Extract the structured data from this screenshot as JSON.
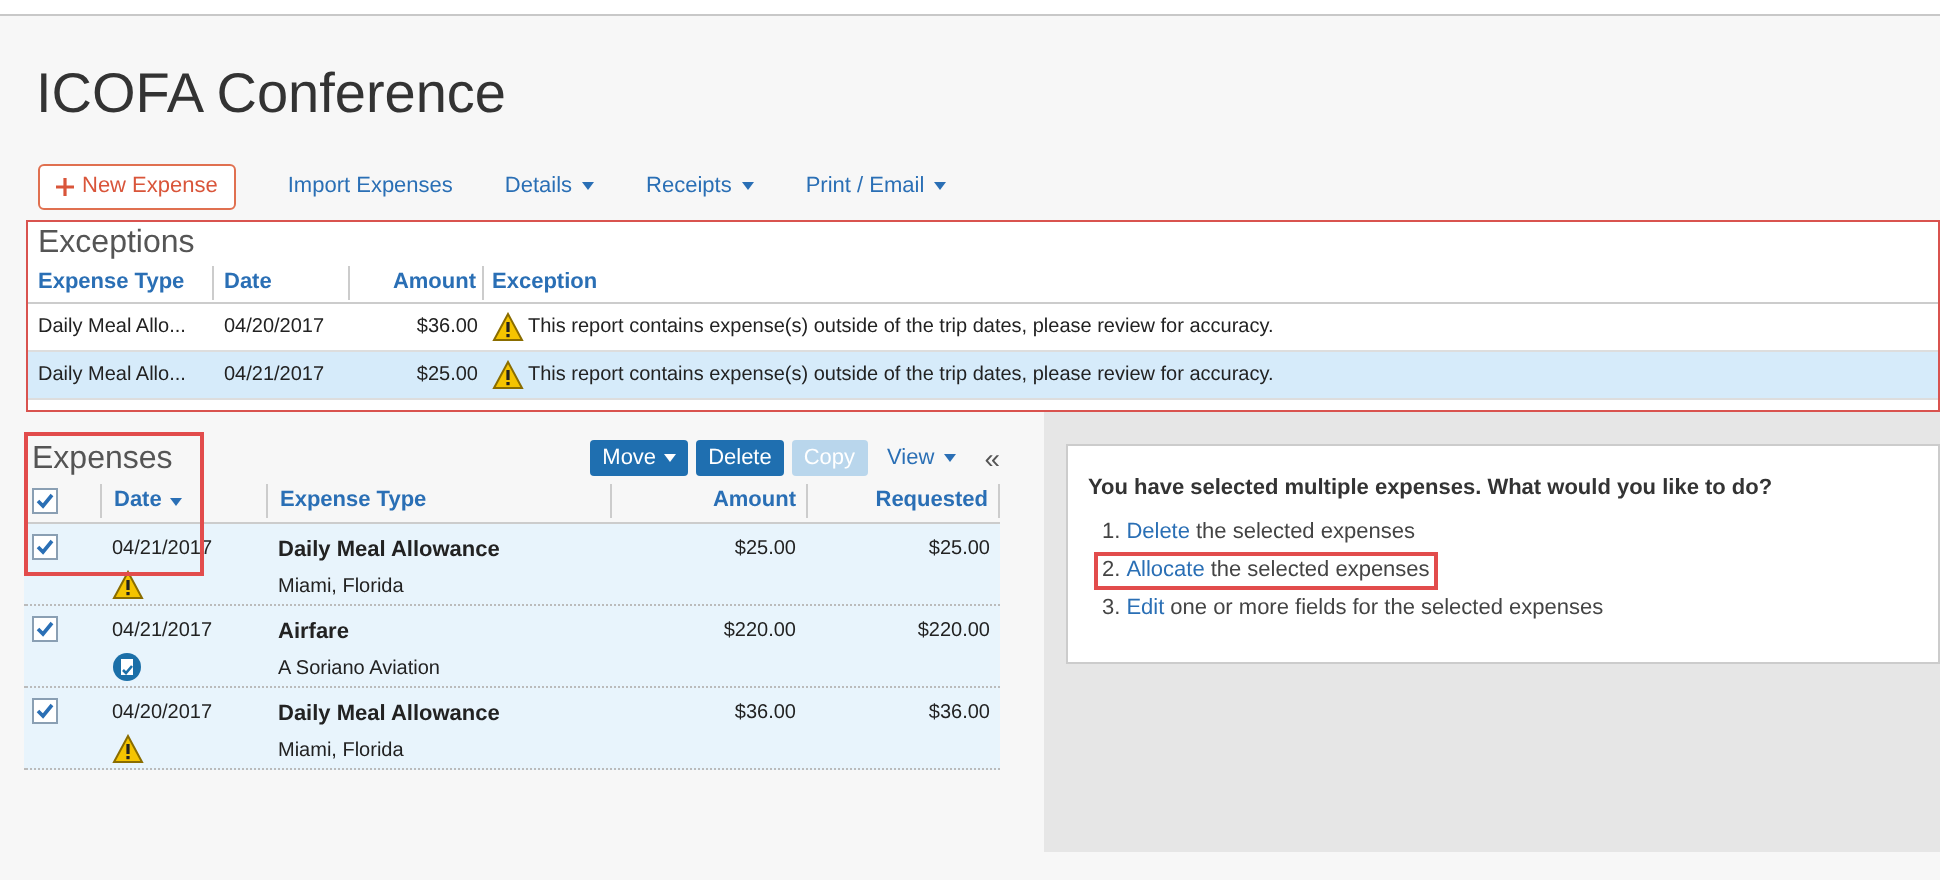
{
  "title": "ICOFA Conference",
  "toolbar": [
    {
      "label": "New Expense",
      "kind": "primary"
    },
    {
      "label": "Import Expenses",
      "kind": "link"
    },
    {
      "label": "Details",
      "kind": "menu"
    },
    {
      "label": "Receipts",
      "kind": "menu"
    },
    {
      "label": "Print / Email",
      "kind": "menu"
    }
  ],
  "exceptions": {
    "title": "Exceptions",
    "columns": [
      "Expense Type",
      "Date",
      "Amount",
      "Exception"
    ],
    "rows": [
      {
        "expense_type": "Daily Meal Allo...",
        "date": "04/20/2017",
        "amount": "$36.00",
        "exception": "This report contains expense(s) outside of the trip dates, please review for accuracy.",
        "selected": false
      },
      {
        "expense_type": "Daily Meal Allo...",
        "date": "04/21/2017",
        "amount": "$25.00",
        "exception": "This report contains expense(s) outside of the trip dates, please review for accuracy.",
        "selected": true
      }
    ]
  },
  "expenses": {
    "title": "Expenses",
    "highlighted": true,
    "buttons": [
      {
        "label": "Move",
        "kind": "menu",
        "disabled": false
      },
      {
        "label": "Delete",
        "kind": "plain",
        "disabled": false
      },
      {
        "label": "Copy",
        "kind": "plain",
        "disabled": true
      },
      {
        "label": "View",
        "kind": "link-menu",
        "disabled": false
      }
    ],
    "collapse": "«",
    "all_checked": true,
    "columns": [
      "Date",
      "Expense Type",
      "Amount",
      "Requested"
    ],
    "rows": [
      {
        "checked": true,
        "date": "04/21/2017",
        "kind": "flagged",
        "expense_type": "Daily Meal Allowance",
        "location": "Miami, Florida",
        "amount": "$25.00",
        "requested": "$25.00"
      },
      {
        "checked": true,
        "date": "04/21/2017",
        "kind": "receipt",
        "expense_type": "Airfare",
        "location": "A Soriano Aviation",
        "amount": "$220.00",
        "requested": "$220.00"
      },
      {
        "checked": true,
        "date": "04/20/2017",
        "kind": "flagged",
        "expense_type": "Daily Meal Allowance",
        "location": "Miami, Florida",
        "amount": "$36.00",
        "requested": "$36.00"
      }
    ]
  },
  "actions": {
    "prompt": "You have selected multiple expenses. What would you like to do?",
    "options": [
      {
        "number": "1.",
        "link": "Delete",
        "text": "the selected expenses",
        "highlighted": false
      },
      {
        "number": "2.",
        "link": "Allocate",
        "text": "the selected expenses",
        "highlighted": true
      },
      {
        "number": "3.",
        "link": "Edit",
        "text": "one or more fields for the selected expenses",
        "highlighted": false
      }
    ]
  }
}
